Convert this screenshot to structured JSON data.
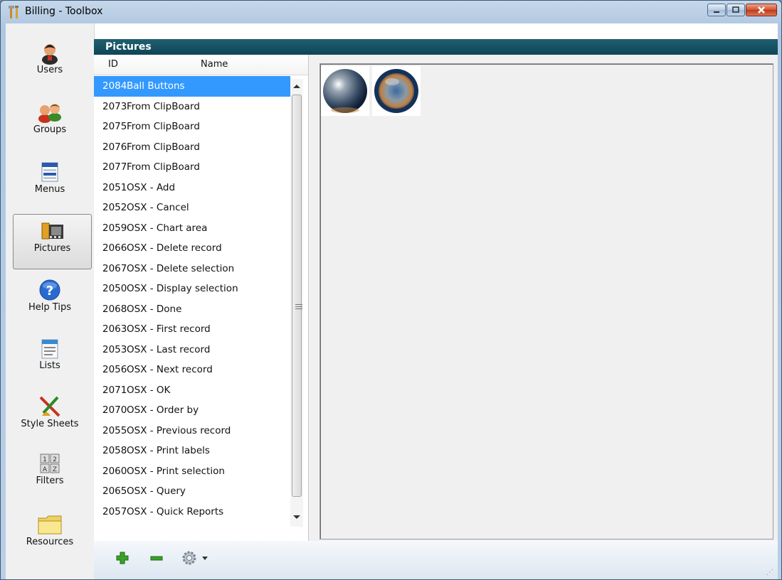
{
  "window": {
    "title": "Billing - Toolbox"
  },
  "sidebar": {
    "items": [
      {
        "label": "Users",
        "icon": "user-icon"
      },
      {
        "label": "Groups",
        "icon": "group-icon"
      },
      {
        "label": "Menus",
        "icon": "menu-icon"
      },
      {
        "label": "Pictures",
        "icon": "film-icon",
        "active": true
      },
      {
        "label": "Help Tips",
        "icon": "help-icon"
      },
      {
        "label": "Lists",
        "icon": "list-icon"
      },
      {
        "label": "Style Sheets",
        "icon": "brush-icon"
      },
      {
        "label": "Filters",
        "icon": "filter-icon"
      },
      {
        "label": "Resources",
        "icon": "folder-icon"
      }
    ]
  },
  "header": {
    "title": "Pictures"
  },
  "list": {
    "columns": [
      "ID",
      "Name"
    ],
    "rows": [
      {
        "id": "2084",
        "name": "Ball Buttons"
      },
      {
        "id": "2073",
        "name": "From ClipBoard"
      },
      {
        "id": "2075",
        "name": "From ClipBoard"
      },
      {
        "id": "2076",
        "name": "From ClipBoard"
      },
      {
        "id": "2077",
        "name": "From ClipBoard"
      },
      {
        "id": "2051",
        "name": "OSX - Add"
      },
      {
        "id": "2052",
        "name": "OSX - Cancel"
      },
      {
        "id": "2059",
        "name": "OSX - Chart area"
      },
      {
        "id": "2066",
        "name": "OSX - Delete record"
      },
      {
        "id": "2067",
        "name": "OSX - Delete selection"
      },
      {
        "id": "2050",
        "name": "OSX - Display selection"
      },
      {
        "id": "2068",
        "name": "OSX - Done"
      },
      {
        "id": "2063",
        "name": "OSX - First record"
      },
      {
        "id": "2053",
        "name": "OSX - Last record"
      },
      {
        "id": "2056",
        "name": "OSX - Next record"
      },
      {
        "id": "2071",
        "name": "OSX - OK"
      },
      {
        "id": "2070",
        "name": "OSX - Order by"
      },
      {
        "id": "2055",
        "name": "OSX - Previous record"
      },
      {
        "id": "2058",
        "name": "OSX - Print labels"
      },
      {
        "id": "2060",
        "name": "OSX - Print selection"
      },
      {
        "id": "2065",
        "name": "OSX - Query"
      },
      {
        "id": "2057",
        "name": "OSX - Quick Reports"
      }
    ],
    "selected_index": 0
  },
  "preview": {
    "thumbnails": [
      "ball-button-icon",
      "ball-button-pressed-icon"
    ]
  },
  "toolbar": {
    "buttons": [
      "add-icon",
      "remove-icon",
      "gear-dropdown-icon"
    ]
  },
  "colors": {
    "header": "#0f4556",
    "selection": "#3399ff"
  }
}
